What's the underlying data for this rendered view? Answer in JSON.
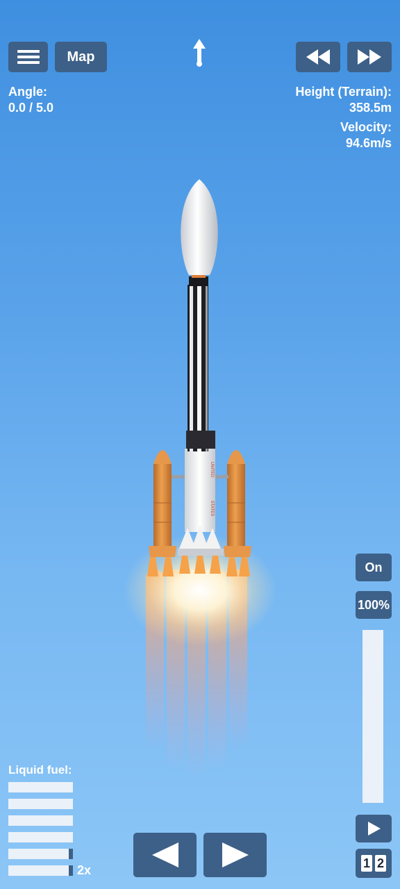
{
  "top": {
    "menu_icon": "hamburger-icon",
    "map_label": "Map",
    "heading_icon": "up-arrow-icon",
    "rewind_icon": "rewind-icon",
    "fast_forward_icon": "fast-forward-icon"
  },
  "angle": {
    "label": "Angle:",
    "value": "0.0 / 5.0"
  },
  "height": {
    "label": "Height (Terrain):",
    "value": "358.5m"
  },
  "velocity": {
    "label": "Velocity:",
    "value": "94.6m/s"
  },
  "right_panel": {
    "toggle_label": "On",
    "throttle_label": "100%",
    "throttle_level": 1.0,
    "play_icon": "play-icon",
    "stage_digits": [
      "1",
      "2"
    ]
  },
  "fuel": {
    "label": "Liquid fuel:",
    "levels": [
      1.0,
      1.0,
      1.0,
      1.0,
      0.94,
      0.94
    ],
    "multiplier": "2x"
  },
  "controls": {
    "left_icon": "rotate-left-icon",
    "right_icon": "rotate-right-icon"
  },
  "rocket": {
    "text_top": "UNITED",
    "text_bottom": "STATES"
  },
  "colors": {
    "button": "#3d6088",
    "sky_top": "#3f8fe0",
    "sky_bottom": "#8cc6f6",
    "booster": "#e0913f",
    "flame": "#ffd27a"
  }
}
